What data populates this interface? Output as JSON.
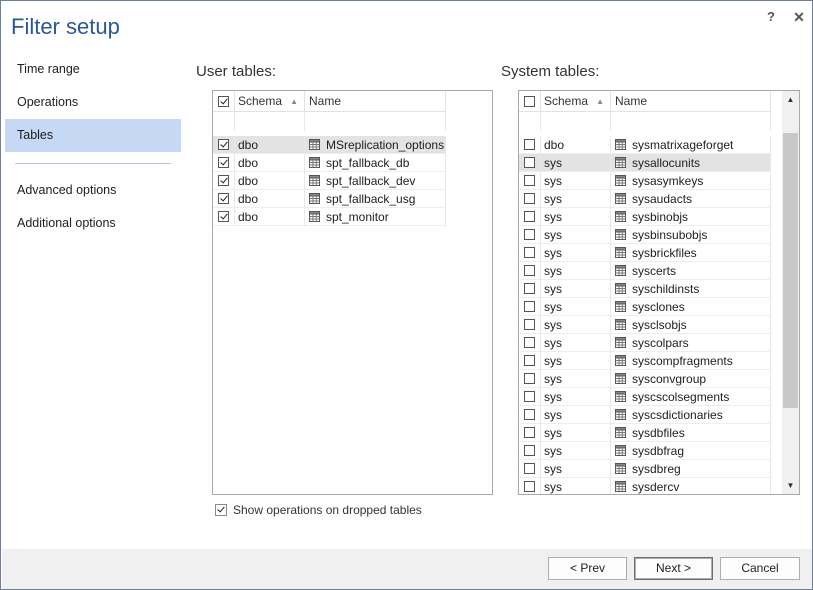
{
  "window": {
    "title": "Filter setup",
    "help": "?",
    "close": "✕"
  },
  "nav": {
    "items": [
      {
        "label": "Time range",
        "active": false
      },
      {
        "label": "Operations",
        "active": false
      },
      {
        "label": "Tables",
        "active": true
      }
    ],
    "items2": [
      {
        "label": "Advanced options"
      },
      {
        "label": "Additional options"
      }
    ]
  },
  "user_tables": {
    "label": "User tables:",
    "header": {
      "all_checked": true,
      "schema": "Schema",
      "name": "Name"
    },
    "rows": [
      {
        "checked": true,
        "schema": "dbo",
        "name": "MSreplication_options",
        "selected": true
      },
      {
        "checked": true,
        "schema": "dbo",
        "name": "spt_fallback_db",
        "selected": false
      },
      {
        "checked": true,
        "schema": "dbo",
        "name": "spt_fallback_dev",
        "selected": false
      },
      {
        "checked": true,
        "schema": "dbo",
        "name": "spt_fallback_usg",
        "selected": false
      },
      {
        "checked": true,
        "schema": "dbo",
        "name": "spt_monitor",
        "selected": false
      }
    ]
  },
  "system_tables": {
    "label": "System tables:",
    "header": {
      "all_checked": false,
      "schema": "Schema",
      "name": "Name"
    },
    "rows": [
      {
        "checked": false,
        "schema": "dbo",
        "name": "sysmatrixageforget",
        "selected": false
      },
      {
        "checked": false,
        "schema": "sys",
        "name": "sysallocunits",
        "selected": true
      },
      {
        "checked": false,
        "schema": "sys",
        "name": "sysasymkeys",
        "selected": false
      },
      {
        "checked": false,
        "schema": "sys",
        "name": "sysaudacts",
        "selected": false
      },
      {
        "checked": false,
        "schema": "sys",
        "name": "sysbinobjs",
        "selected": false
      },
      {
        "checked": false,
        "schema": "sys",
        "name": "sysbinsubobjs",
        "selected": false
      },
      {
        "checked": false,
        "schema": "sys",
        "name": "sysbrickfiles",
        "selected": false
      },
      {
        "checked": false,
        "schema": "sys",
        "name": "syscerts",
        "selected": false
      },
      {
        "checked": false,
        "schema": "sys",
        "name": "syschildinsts",
        "selected": false
      },
      {
        "checked": false,
        "schema": "sys",
        "name": "sysclones",
        "selected": false
      },
      {
        "checked": false,
        "schema": "sys",
        "name": "sysclsobjs",
        "selected": false
      },
      {
        "checked": false,
        "schema": "sys",
        "name": "syscolpars",
        "selected": false
      },
      {
        "checked": false,
        "schema": "sys",
        "name": "syscompfragments",
        "selected": false
      },
      {
        "checked": false,
        "schema": "sys",
        "name": "sysconvgroup",
        "selected": false
      },
      {
        "checked": false,
        "schema": "sys",
        "name": "syscscolsegments",
        "selected": false
      },
      {
        "checked": false,
        "schema": "sys",
        "name": "syscsdictionaries",
        "selected": false
      },
      {
        "checked": false,
        "schema": "sys",
        "name": "sysdbfiles",
        "selected": false
      },
      {
        "checked": false,
        "schema": "sys",
        "name": "sysdbfrag",
        "selected": false
      },
      {
        "checked": false,
        "schema": "sys",
        "name": "sysdbreg",
        "selected": false
      },
      {
        "checked": false,
        "schema": "sys",
        "name": "sysdercv",
        "selected": false
      }
    ],
    "scroll_position": 0.27
  },
  "show_dropped": {
    "label": "Show operations on dropped tables",
    "checked": true
  },
  "footer": {
    "prev": "< Prev",
    "next": "Next >",
    "cancel": "Cancel"
  },
  "colors": {
    "accent": "#2b579a",
    "nav_active": "#c5d8f4",
    "row_selected": "#e3e3e3"
  }
}
